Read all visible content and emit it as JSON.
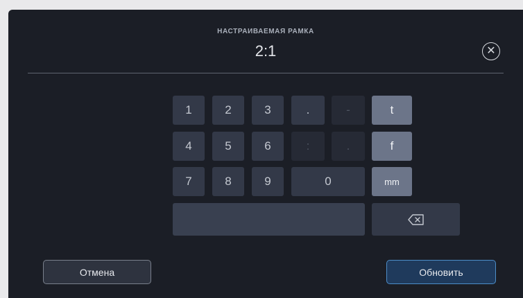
{
  "dialog": {
    "title": "НАСТРАИВАЕМАЯ РАМКА",
    "value": "2:1",
    "close_icon": "close-circle-icon"
  },
  "keypad": {
    "keys": [
      "1",
      "2",
      "3",
      ".",
      "-",
      "t",
      "4",
      "5",
      "6",
      ":",
      ".",
      "f",
      "7",
      "8",
      "9",
      "0",
      "mm"
    ],
    "backspace_icon": "backspace-icon"
  },
  "actions": {
    "cancel_label": "Отмена",
    "update_label": "Обновить"
  },
  "colors": {
    "background": "#1b1e26",
    "key": "#333948",
    "unit_key": "#6c7589",
    "accent": "#4d8ec9"
  }
}
